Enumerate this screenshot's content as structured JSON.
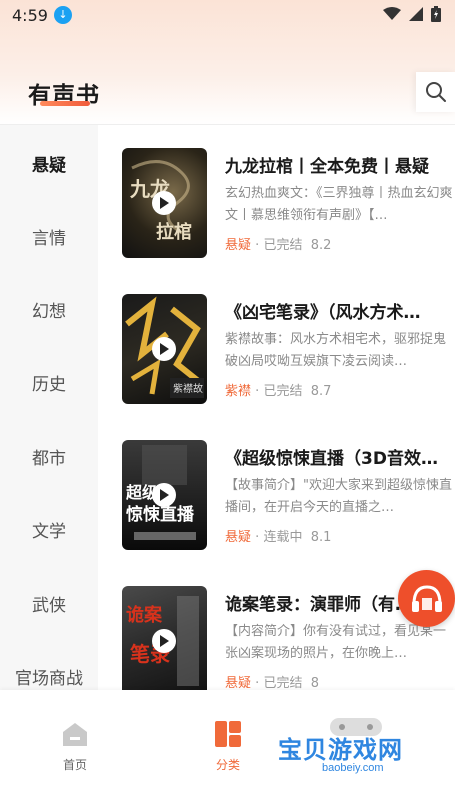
{
  "status_bar": {
    "time": "4:59"
  },
  "header": {
    "title": "有声书"
  },
  "sidebar": {
    "items": [
      {
        "label": "悬疑",
        "active": true
      },
      {
        "label": "言情"
      },
      {
        "label": "幻想"
      },
      {
        "label": "历史"
      },
      {
        "label": "都市"
      },
      {
        "label": "文学"
      },
      {
        "label": "武侠"
      },
      {
        "label": "官场商战"
      }
    ]
  },
  "books": [
    {
      "title": "九龙拉棺丨全本免费丨悬疑",
      "desc": "玄幻热血爽文：《三界独尊丨热血玄幻爽文丨慕思维领衔有声剧》【…",
      "category": "悬疑",
      "sep": "·",
      "status": "已完结",
      "rating": "8.2",
      "cover_text": "九龙拉棺"
    },
    {
      "title": "《凶宅笔录》（风水方术…",
      "desc": "紫襟故事：风水方术相宅术，驱邪捉鬼破凶局哎呦互娱旗下凌云阅读…",
      "category": "紫襟",
      "sep": "·",
      "status": "已完结",
      "rating": "8.7",
      "cover_text": "凶宅笔录"
    },
    {
      "title": "《超级惊悚直播（3D音效…",
      "desc": "【故事简介】\"欢迎大家来到超级惊悚直播间，在开启今天的直播之…",
      "category": "悬疑",
      "sep": "·",
      "status": "连载中",
      "rating": "8.1",
      "cover_text": "超级惊悚直播"
    },
    {
      "title": "诡案笔录：演罪师（有…",
      "desc": "【内容简介】你有没有试过，看见某一张凶案现场的照片，在你晚上…",
      "category": "悬疑",
      "sep": "·",
      "status": "已完结",
      "rating": "8",
      "cover_text": "诡案笔录"
    }
  ],
  "bottom_nav": {
    "items": [
      {
        "label": "首页"
      },
      {
        "label": "分类",
        "active": true
      }
    ]
  },
  "watermark": {
    "text": "宝贝游戏网",
    "url": "baobeiy.com"
  },
  "colors": {
    "accent": "#f06a3a",
    "float_button": "#ee4f2b"
  }
}
